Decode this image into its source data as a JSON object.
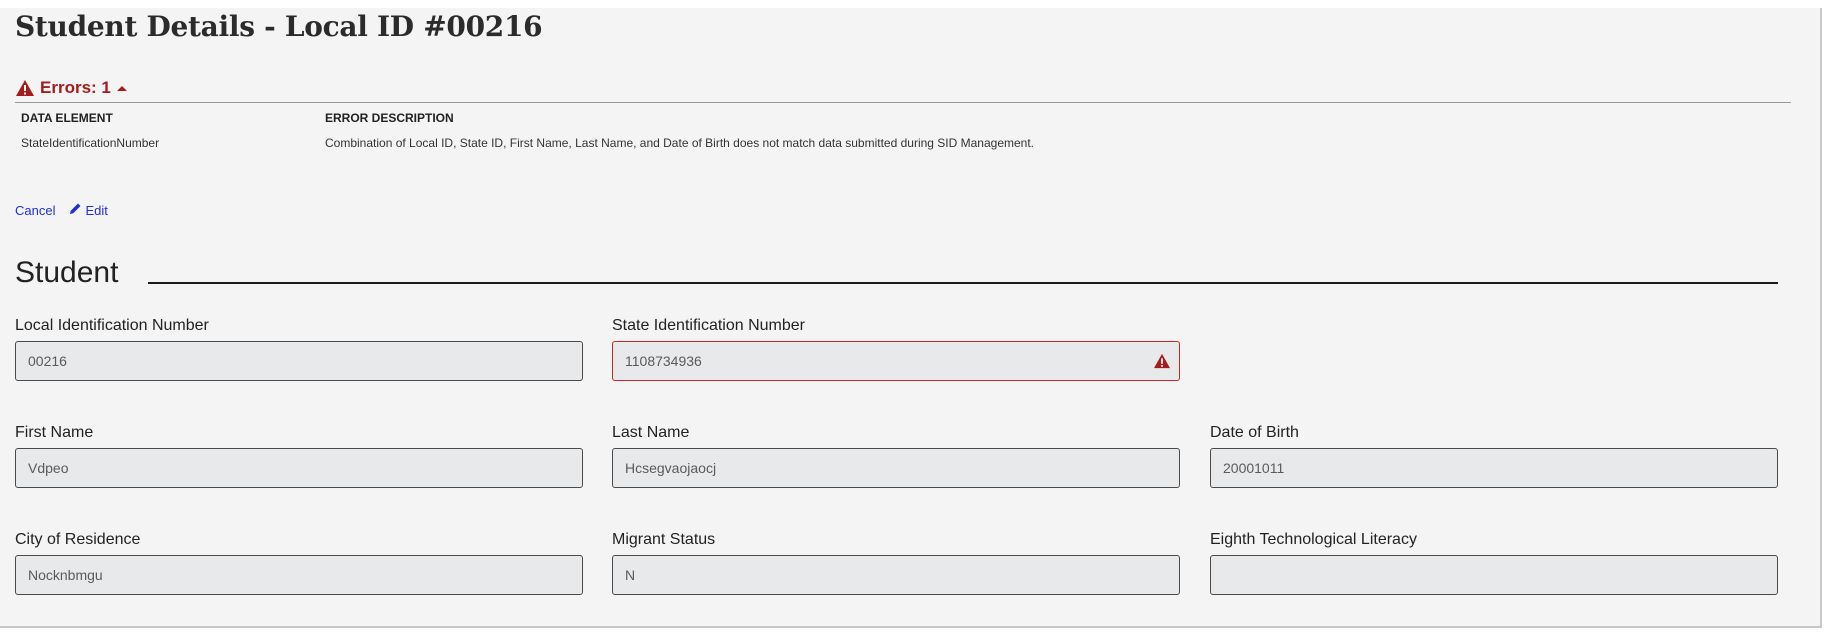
{
  "page": {
    "title": "Student Details - Local ID #00216"
  },
  "errors": {
    "label": "Errors: 1",
    "colors": {
      "error": "#a51c1c",
      "link": "#2130d8"
    },
    "columns": [
      "DATA ELEMENT",
      "ERROR DESCRIPTION"
    ],
    "rows": [
      {
        "element": "StateIdentificationNumber",
        "description": "Combination of Local ID, State ID, First Name, Last Name, and Date of Birth does not match data submitted during SID Management."
      }
    ]
  },
  "actions": {
    "cancel_label": "Cancel",
    "edit_label": "Edit"
  },
  "section": {
    "title": "Student"
  },
  "fields": {
    "local_id": {
      "label": "Local Identification Number",
      "value": "00216"
    },
    "state_id": {
      "label": "State Identification Number",
      "value": "1108734936",
      "has_error": true
    },
    "first_name": {
      "label": "First Name",
      "value": "Vdpeo"
    },
    "last_name": {
      "label": "Last Name",
      "value": "Hcsegvaojaocj"
    },
    "dob": {
      "label": "Date of Birth",
      "value": "20001011"
    },
    "city": {
      "label": "City of Residence",
      "value": "Nocknbmgu"
    },
    "migrant": {
      "label": "Migrant Status",
      "value": "N"
    },
    "tech_lit": {
      "label": "Eighth Technological Literacy",
      "value": ""
    }
  },
  "icons": {
    "error_warning": "warning-triangle-icon",
    "collapse": "caret-up-icon",
    "edit": "pencil-icon"
  }
}
